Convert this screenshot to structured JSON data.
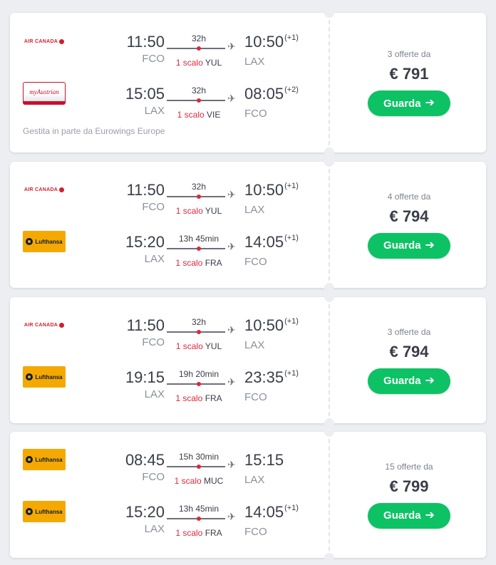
{
  "cards": [
    {
      "offers": "3 offerte da",
      "price": "€ 791",
      "button_label": "Guarda",
      "operated_note": "Gestita in parte da Eurowings Europe",
      "legs": [
        {
          "airline": "Air Canada",
          "logo_text": "AIR CANADA",
          "logo": "aircanada",
          "dep_time": "11:50",
          "dep_airport": "FCO",
          "duration": "32h",
          "stops": "1 scalo",
          "via": "YUL",
          "arr_time": "10:50",
          "day_offset": "(+1)",
          "arr_airport": "LAX"
        },
        {
          "airline": "Austrian",
          "logo_text": "myAustrian",
          "logo": "austrian",
          "dep_time": "15:05",
          "dep_airport": "LAX",
          "duration": "32h",
          "stops": "1 scalo",
          "via": "VIE",
          "arr_time": "08:05",
          "day_offset": "(+2)",
          "arr_airport": "FCO"
        }
      ]
    },
    {
      "offers": "4 offerte da",
      "price": "€ 794",
      "button_label": "Guarda",
      "operated_note": "",
      "legs": [
        {
          "airline": "Air Canada",
          "logo_text": "AIR CANADA",
          "logo": "aircanada",
          "dep_time": "11:50",
          "dep_airport": "FCO",
          "duration": "32h",
          "stops": "1 scalo",
          "via": "YUL",
          "arr_time": "10:50",
          "day_offset": "(+1)",
          "arr_airport": "LAX"
        },
        {
          "airline": "Lufthansa",
          "logo_text": "Lufthansa",
          "logo": "lufthansa",
          "dep_time": "15:20",
          "dep_airport": "LAX",
          "duration": "13h 45min",
          "stops": "1 scalo",
          "via": "FRA",
          "arr_time": "14:05",
          "day_offset": "(+1)",
          "arr_airport": "FCO"
        }
      ]
    },
    {
      "offers": "3 offerte da",
      "price": "€ 794",
      "button_label": "Guarda",
      "operated_note": "",
      "legs": [
        {
          "airline": "Air Canada",
          "logo_text": "AIR CANADA",
          "logo": "aircanada",
          "dep_time": "11:50",
          "dep_airport": "FCO",
          "duration": "32h",
          "stops": "1 scalo",
          "via": "YUL",
          "arr_time": "10:50",
          "day_offset": "(+1)",
          "arr_airport": "LAX"
        },
        {
          "airline": "Lufthansa",
          "logo_text": "Lufthansa",
          "logo": "lufthansa",
          "dep_time": "19:15",
          "dep_airport": "LAX",
          "duration": "19h 20min",
          "stops": "1 scalo",
          "via": "FRA",
          "arr_time": "23:35",
          "day_offset": "(+1)",
          "arr_airport": "FCO"
        }
      ]
    },
    {
      "offers": "15 offerte da",
      "price": "€ 799",
      "button_label": "Guarda",
      "operated_note": "",
      "legs": [
        {
          "airline": "Lufthansa",
          "logo_text": "Lufthansa",
          "logo": "lufthansa",
          "dep_time": "08:45",
          "dep_airport": "FCO",
          "duration": "15h 30min",
          "stops": "1 scalo",
          "via": "MUC",
          "arr_time": "15:15",
          "day_offset": "",
          "arr_airport": "LAX"
        },
        {
          "airline": "Lufthansa",
          "logo_text": "Lufthansa",
          "logo": "lufthansa",
          "dep_time": "15:20",
          "dep_airport": "LAX",
          "duration": "13h 45min",
          "stops": "1 scalo",
          "via": "FRA",
          "arr_time": "14:05",
          "day_offset": "(+1)",
          "arr_airport": "FCO"
        }
      ]
    }
  ],
  "icons": {
    "arrow": "arrow-right-icon",
    "plane": "plane-icon"
  },
  "colors": {
    "accent_green": "#0cc265",
    "stop_red": "#e0263c",
    "aircanada_red": "#d21e2b",
    "lufthansa_yellow": "#f5a800"
  }
}
